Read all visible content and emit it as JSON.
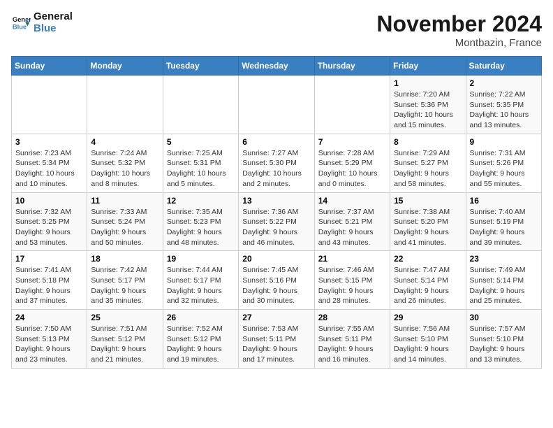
{
  "header": {
    "logo_line1": "General",
    "logo_line2": "Blue",
    "month": "November 2024",
    "location": "Montbazin, France"
  },
  "days_of_week": [
    "Sunday",
    "Monday",
    "Tuesday",
    "Wednesday",
    "Thursday",
    "Friday",
    "Saturday"
  ],
  "weeks": [
    [
      {
        "day": "",
        "info": ""
      },
      {
        "day": "",
        "info": ""
      },
      {
        "day": "",
        "info": ""
      },
      {
        "day": "",
        "info": ""
      },
      {
        "day": "",
        "info": ""
      },
      {
        "day": "1",
        "info": "Sunrise: 7:20 AM\nSunset: 5:36 PM\nDaylight: 10 hours and 15 minutes."
      },
      {
        "day": "2",
        "info": "Sunrise: 7:22 AM\nSunset: 5:35 PM\nDaylight: 10 hours and 13 minutes."
      }
    ],
    [
      {
        "day": "3",
        "info": "Sunrise: 7:23 AM\nSunset: 5:34 PM\nDaylight: 10 hours and 10 minutes."
      },
      {
        "day": "4",
        "info": "Sunrise: 7:24 AM\nSunset: 5:32 PM\nDaylight: 10 hours and 8 minutes."
      },
      {
        "day": "5",
        "info": "Sunrise: 7:25 AM\nSunset: 5:31 PM\nDaylight: 10 hours and 5 minutes."
      },
      {
        "day": "6",
        "info": "Sunrise: 7:27 AM\nSunset: 5:30 PM\nDaylight: 10 hours and 2 minutes."
      },
      {
        "day": "7",
        "info": "Sunrise: 7:28 AM\nSunset: 5:29 PM\nDaylight: 10 hours and 0 minutes."
      },
      {
        "day": "8",
        "info": "Sunrise: 7:29 AM\nSunset: 5:27 PM\nDaylight: 9 hours and 58 minutes."
      },
      {
        "day": "9",
        "info": "Sunrise: 7:31 AM\nSunset: 5:26 PM\nDaylight: 9 hours and 55 minutes."
      }
    ],
    [
      {
        "day": "10",
        "info": "Sunrise: 7:32 AM\nSunset: 5:25 PM\nDaylight: 9 hours and 53 minutes."
      },
      {
        "day": "11",
        "info": "Sunrise: 7:33 AM\nSunset: 5:24 PM\nDaylight: 9 hours and 50 minutes."
      },
      {
        "day": "12",
        "info": "Sunrise: 7:35 AM\nSunset: 5:23 PM\nDaylight: 9 hours and 48 minutes."
      },
      {
        "day": "13",
        "info": "Sunrise: 7:36 AM\nSunset: 5:22 PM\nDaylight: 9 hours and 46 minutes."
      },
      {
        "day": "14",
        "info": "Sunrise: 7:37 AM\nSunset: 5:21 PM\nDaylight: 9 hours and 43 minutes."
      },
      {
        "day": "15",
        "info": "Sunrise: 7:38 AM\nSunset: 5:20 PM\nDaylight: 9 hours and 41 minutes."
      },
      {
        "day": "16",
        "info": "Sunrise: 7:40 AM\nSunset: 5:19 PM\nDaylight: 9 hours and 39 minutes."
      }
    ],
    [
      {
        "day": "17",
        "info": "Sunrise: 7:41 AM\nSunset: 5:18 PM\nDaylight: 9 hours and 37 minutes."
      },
      {
        "day": "18",
        "info": "Sunrise: 7:42 AM\nSunset: 5:17 PM\nDaylight: 9 hours and 35 minutes."
      },
      {
        "day": "19",
        "info": "Sunrise: 7:44 AM\nSunset: 5:17 PM\nDaylight: 9 hours and 32 minutes."
      },
      {
        "day": "20",
        "info": "Sunrise: 7:45 AM\nSunset: 5:16 PM\nDaylight: 9 hours and 30 minutes."
      },
      {
        "day": "21",
        "info": "Sunrise: 7:46 AM\nSunset: 5:15 PM\nDaylight: 9 hours and 28 minutes."
      },
      {
        "day": "22",
        "info": "Sunrise: 7:47 AM\nSunset: 5:14 PM\nDaylight: 9 hours and 26 minutes."
      },
      {
        "day": "23",
        "info": "Sunrise: 7:49 AM\nSunset: 5:14 PM\nDaylight: 9 hours and 25 minutes."
      }
    ],
    [
      {
        "day": "24",
        "info": "Sunrise: 7:50 AM\nSunset: 5:13 PM\nDaylight: 9 hours and 23 minutes."
      },
      {
        "day": "25",
        "info": "Sunrise: 7:51 AM\nSunset: 5:12 PM\nDaylight: 9 hours and 21 minutes."
      },
      {
        "day": "26",
        "info": "Sunrise: 7:52 AM\nSunset: 5:12 PM\nDaylight: 9 hours and 19 minutes."
      },
      {
        "day": "27",
        "info": "Sunrise: 7:53 AM\nSunset: 5:11 PM\nDaylight: 9 hours and 17 minutes."
      },
      {
        "day": "28",
        "info": "Sunrise: 7:55 AM\nSunset: 5:11 PM\nDaylight: 9 hours and 16 minutes."
      },
      {
        "day": "29",
        "info": "Sunrise: 7:56 AM\nSunset: 5:10 PM\nDaylight: 9 hours and 14 minutes."
      },
      {
        "day": "30",
        "info": "Sunrise: 7:57 AM\nSunset: 5:10 PM\nDaylight: 9 hours and 13 minutes."
      }
    ]
  ]
}
